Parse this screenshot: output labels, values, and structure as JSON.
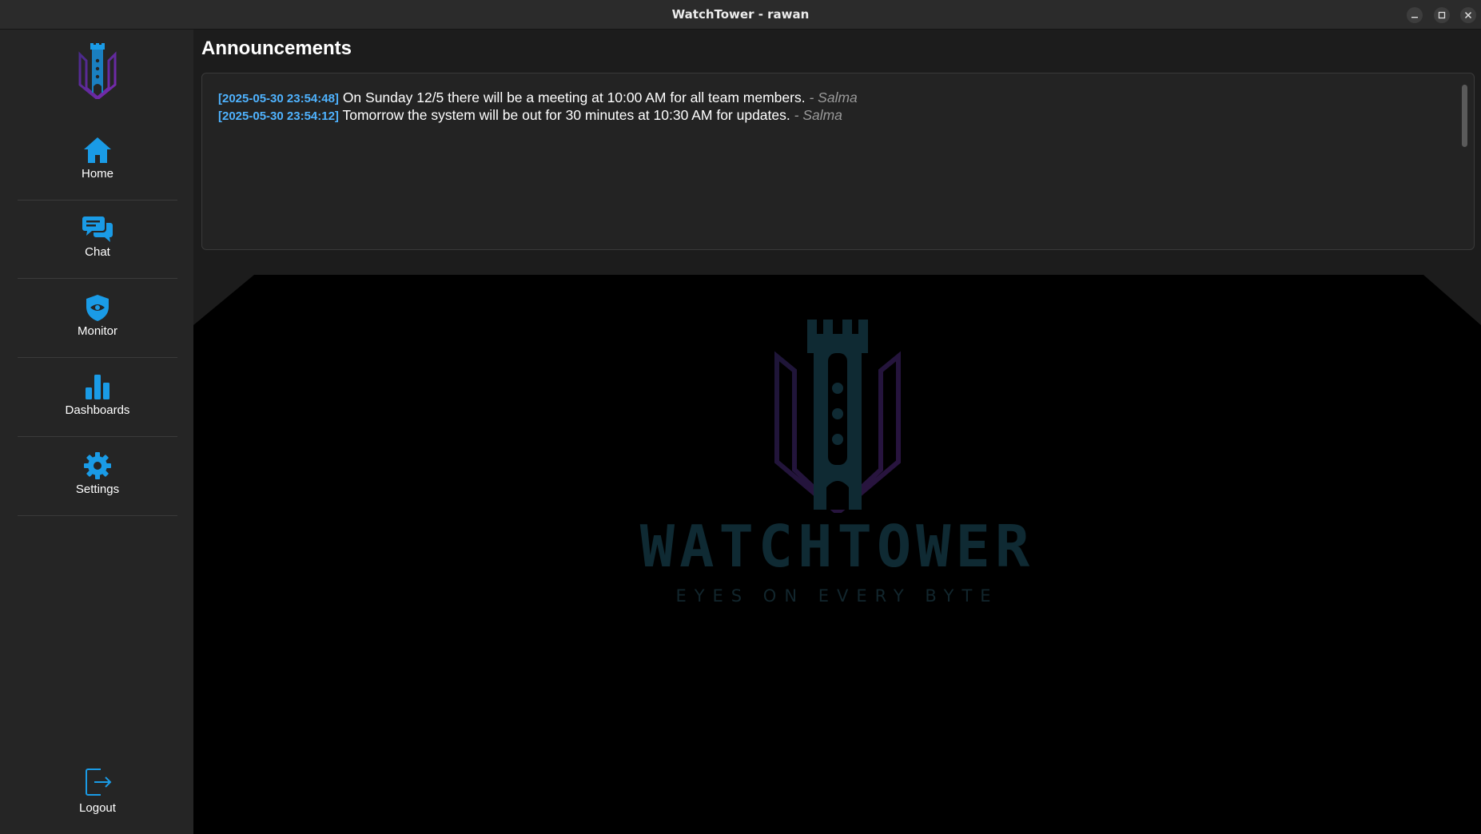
{
  "window": {
    "title": "WatchTower - rawan"
  },
  "sidebar": {
    "items": [
      {
        "label": "Home"
      },
      {
        "label": "Chat"
      },
      {
        "label": "Monitor"
      },
      {
        "label": "Dashboards"
      },
      {
        "label": "Settings"
      }
    ],
    "logout_label": "Logout"
  },
  "announcements": {
    "heading": "Announcements",
    "items": [
      {
        "timestamp": "[2025-05-30 23:54:48]",
        "message": "On Sunday 12/5 there will be a meeting at 10:00 AM for all team members.",
        "author": "- Salma"
      },
      {
        "timestamp": "[2025-05-30 23:54:12]",
        "message": "Tomorrow the system will be out for 30 minutes at 10:30 AM for updates.",
        "author": "- Salma"
      }
    ]
  },
  "branding": {
    "name": "WATCHTOWER",
    "tagline": "EYES ON EVERY BYTE"
  },
  "colors": {
    "accent": "#1a9be6",
    "timestamp": "#4fb3ff",
    "sidebar_bg": "#252525",
    "content_bg": "#1c1c1c",
    "splash_bg": "#000000"
  },
  "icons": {
    "home": "home-icon",
    "chat": "chat-icon",
    "monitor": "shield-eye-icon",
    "dashboards": "bar-chart-icon",
    "settings": "gear-icon",
    "logout": "logout-icon"
  }
}
